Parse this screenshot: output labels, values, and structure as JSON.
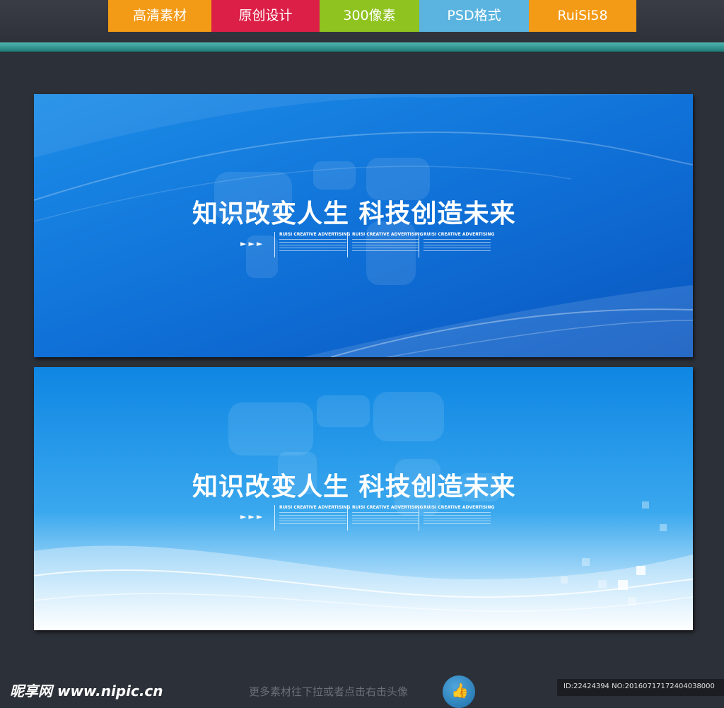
{
  "header": {
    "tabs": [
      {
        "label": "高清素材",
        "color": "#f39a16"
      },
      {
        "label": "原创设计",
        "color": "#dc1f47"
      },
      {
        "label": "300像素",
        "color": "#8fc31f"
      },
      {
        "label": "PSD格式",
        "color": "#5bb4e0"
      },
      {
        "label": "RuiSi58",
        "color": "#f39a16"
      }
    ],
    "accent_line_color": "#2e9b95"
  },
  "panels": [
    {
      "headline": "知识改变人生  科技创造未来",
      "arrows": "►►►",
      "columns": [
        {
          "title": "RUISI CREATIVE ADVERTISING"
        },
        {
          "title": "RUISI CREATIVE ADVERTISING"
        },
        {
          "title": "RUISI CREATIVE ADVERTISING"
        }
      ],
      "background_color": "#1077dc"
    },
    {
      "headline": "知识改变人生  科技创造未来",
      "arrows": "►►►",
      "columns": [
        {
          "title": "RUISI CREATIVE ADVERTISING"
        },
        {
          "title": "RUISI CREATIVE ADVERTISING"
        },
        {
          "title": "RUISI CREATIVE ADVERTISING"
        }
      ],
      "background_color": "#3aa8ee"
    }
  ],
  "footer": {
    "logo": "昵享网 www.nipic.cn",
    "hint": "更多素材往下拉或者点击右击头像",
    "thumb_icon": "thumbs-up-icon",
    "id_text": "ID:22424394 NO:20160717172404038000"
  }
}
